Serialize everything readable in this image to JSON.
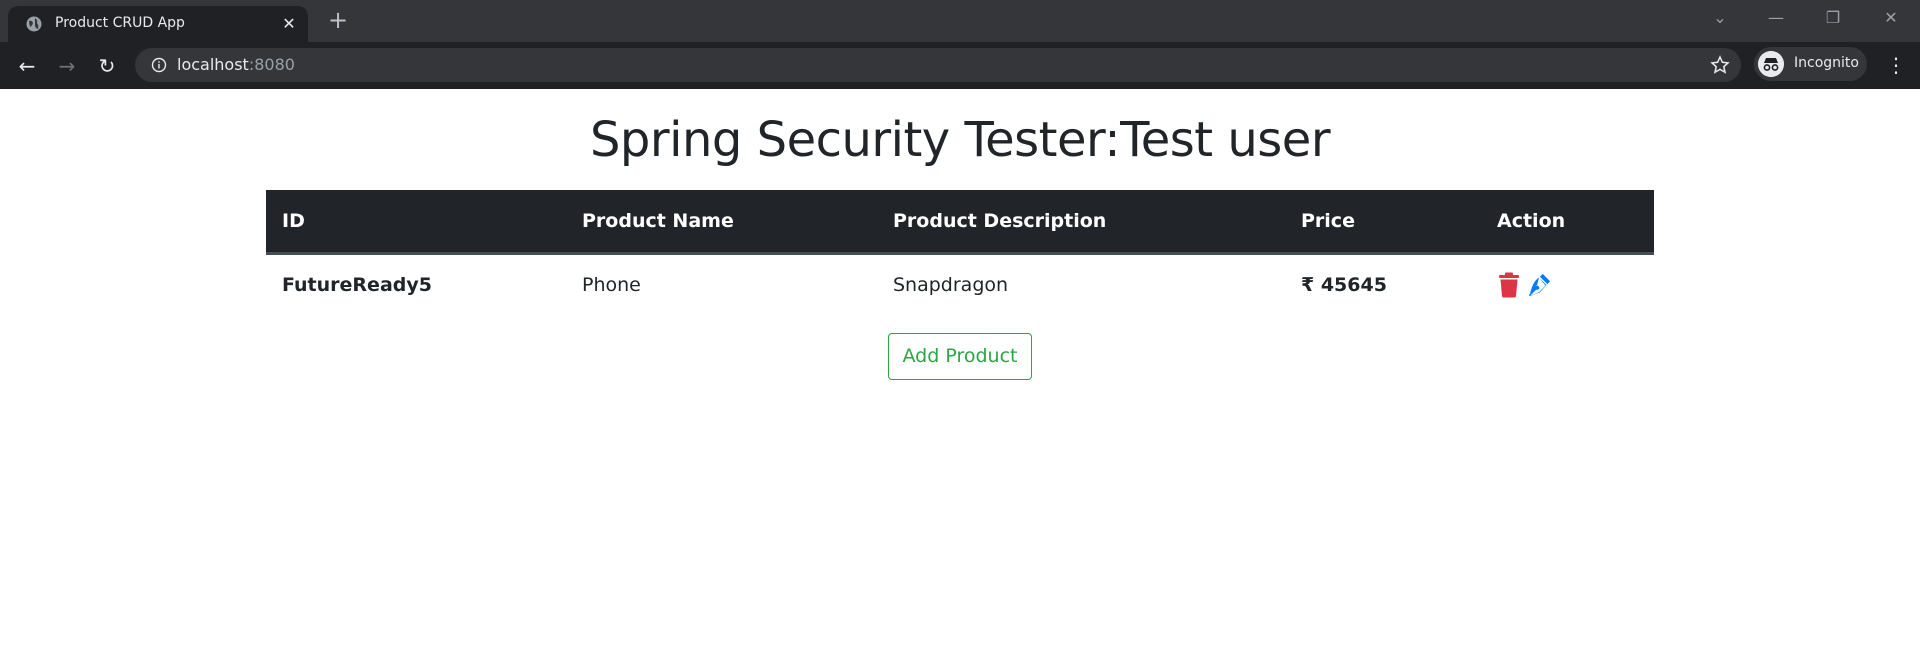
{
  "browser": {
    "tab_title": "Product CRUD App",
    "tab_close": "✕",
    "new_tab": "+",
    "url_host": "localhost",
    "url_port": ":8080",
    "profile_label": "Incognito"
  },
  "page": {
    "heading": "Spring Security Tester:Test user",
    "table": {
      "headers": [
        "ID",
        "Product Name",
        "Product Description",
        "Price",
        "Action"
      ],
      "rows": [
        {
          "id": "FutureReady5",
          "name": "Phone",
          "description": "Snapdragon",
          "price": "₹ 45645"
        }
      ]
    },
    "add_button": "Add Product"
  },
  "colors": {
    "header_bg": "#212529",
    "delete": "#dc3545",
    "edit": "#007bff",
    "success": "#28a745"
  }
}
